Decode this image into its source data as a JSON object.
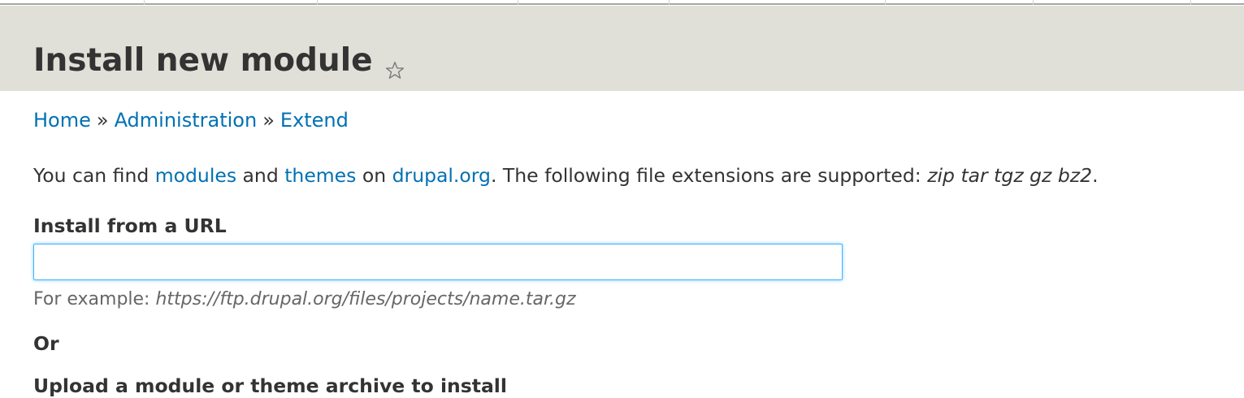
{
  "page": {
    "title": "Install new module"
  },
  "breadcrumb": {
    "items": [
      "Home",
      "Administration",
      "Extend"
    ],
    "separator": "»"
  },
  "intro": {
    "text_1": "You can find ",
    "link_modules": "modules",
    "text_2": " and ",
    "link_themes": "themes",
    "text_3": " on ",
    "link_drupal": "drupal.org",
    "text_4": ". The following file extensions are supported: ",
    "extensions": "zip tar tgz gz bz2",
    "text_5": "."
  },
  "url_field": {
    "label": "Install from a URL",
    "value": "",
    "description_prefix": "For example: ",
    "description_example": "https://ftp.drupal.org/files/projects/name.tar.gz"
  },
  "or_label": "Or",
  "upload_field": {
    "label": "Upload a module or theme archive to install"
  },
  "colors": {
    "link": "#0071b3",
    "header_bg": "#e0e0d8",
    "text": "#333333",
    "focus_border": "#40b6ff"
  },
  "icons": {
    "shortcut": "star-icon"
  }
}
